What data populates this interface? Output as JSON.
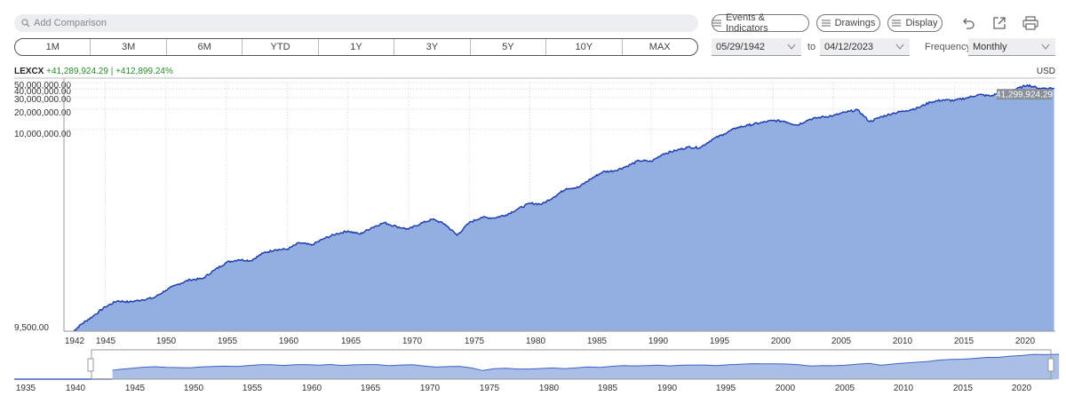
{
  "search": {
    "placeholder": "Add Comparison"
  },
  "toolbar": {
    "events_label": "Events & Indicators",
    "drawings_label": "Drawings",
    "display_label": "Display"
  },
  "ranges": [
    "1M",
    "3M",
    "6M",
    "YTD",
    "1Y",
    "3Y",
    "5Y",
    "10Y",
    "MAX"
  ],
  "dates": {
    "from": "05/29/1942",
    "to_label": "to",
    "to": "04/12/2023"
  },
  "frequency": {
    "label": "Frequency",
    "value": "Monthly"
  },
  "ticker": {
    "symbol": "LEXCX",
    "change": "+41,289,924.29 | +412,899.24%"
  },
  "currency": "USD",
  "last_value_label": "41,299,924.29",
  "colors": {
    "line": "#1f3fb0",
    "area": "#93aee0",
    "nav_area": "#aabfe6"
  },
  "chart_data": {
    "type": "area",
    "yscale": "log",
    "ylim": [
      9500,
      50000000
    ],
    "xlim": [
      1941.6,
      2023.3
    ],
    "y_ticks": [
      "50,000,000.00",
      "40,000,000.00",
      "30,000,000.00",
      "20,000,000.00",
      "10,000,000.00",
      "9,500.00"
    ],
    "x_ticks": [
      "1942",
      "1945",
      "1950",
      "1955",
      "1960",
      "1965",
      "1970",
      "1975",
      "1980",
      "1985",
      "1990",
      "1995",
      "2000",
      "2005",
      "2010",
      "2015",
      "2020"
    ],
    "navigator_x_ticks": [
      "1935",
      "1940",
      "1945",
      "1950",
      "1955",
      "1960",
      "1965",
      "1970",
      "1975",
      "1980",
      "1985",
      "1990",
      "1995",
      "2000",
      "2005",
      "2010",
      "2015",
      "2020"
    ],
    "x": [
      1942.4,
      1943,
      1944,
      1945,
      1946,
      1947,
      1948,
      1949,
      1950,
      1951,
      1952,
      1953,
      1954,
      1955,
      1956,
      1957,
      1958,
      1959,
      1960,
      1961,
      1962,
      1963,
      1964,
      1965,
      1966,
      1967,
      1968,
      1969,
      1970,
      1971,
      1972,
      1973,
      1974,
      1975,
      1976,
      1977,
      1978,
      1979,
      1980,
      1981,
      1982,
      1983,
      1984,
      1985,
      1986,
      1987,
      1988,
      1989,
      1990,
      1991,
      1992,
      1993,
      1994,
      1995,
      1996,
      1997,
      1998,
      1999,
      2000,
      2001,
      2002,
      2003,
      2004,
      2005,
      2006,
      2007,
      2008,
      2009,
      2010,
      2011,
      2012,
      2013,
      2014,
      2015,
      2016,
      2017,
      2018,
      2019,
      2020,
      2021,
      2022,
      2023.2
    ],
    "values": [
      9500,
      12000,
      16000,
      22000,
      27000,
      26000,
      28000,
      30000,
      39000,
      48000,
      56000,
      58000,
      78000,
      102000,
      112000,
      108000,
      140000,
      158000,
      160000,
      200000,
      185000,
      230000,
      270000,
      300000,
      270000,
      340000,
      400000,
      350000,
      320000,
      390000,
      450000,
      380000,
      260000,
      400000,
      480000,
      470000,
      520000,
      640000,
      780000,
      760000,
      980000,
      1300000,
      1350000,
      1800000,
      2300000,
      2400000,
      2800000,
      3400000,
      3300000,
      4300000,
      4800000,
      5400000,
      5300000,
      7000000,
      8500000,
      10500000,
      11500000,
      12500000,
      13500000,
      13200000,
      11500000,
      14000000,
      15200000,
      16000000,
      18000000,
      19500000,
      13000000,
      15500000,
      17500000,
      19000000,
      21000000,
      25500000,
      27500000,
      27000000,
      29500000,
      33000000,
      31500000,
      37000000,
      39500000,
      46000000,
      41000000,
      41299924.29
    ]
  }
}
